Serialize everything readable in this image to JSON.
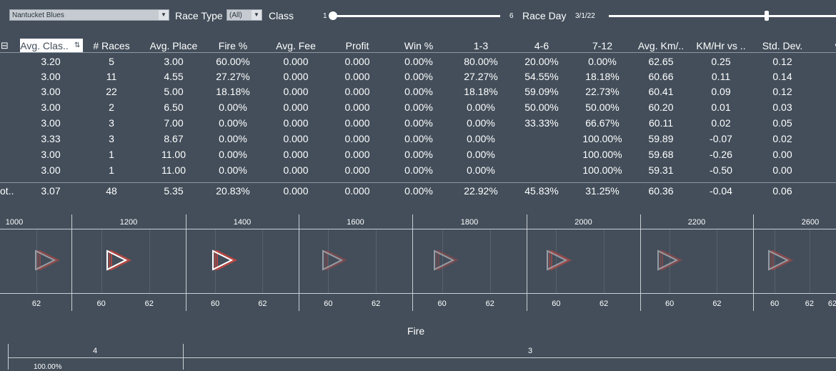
{
  "filters": {
    "track_value": "Nantucket Blues",
    "race_type_label": "Race Type",
    "race_type_value": "(All)",
    "class_label": "Class",
    "class_min": "1",
    "class_max": "6",
    "race_day_label": "Race Day",
    "race_day_value": "3/1/22"
  },
  "table": {
    "columns": [
      "Avg. Clas..",
      "# Races",
      "Avg. Place",
      "Fire %",
      "Avg. Fee",
      "Profit",
      "Win %",
      "1-3",
      "4-6",
      "7-12",
      "Avg. Km/..",
      "KM/Hr vs ..",
      "Std. Dev.",
      "v"
    ],
    "rows": [
      [
        "3.20",
        "5",
        "3.00",
        "60.00%",
        "0.000",
        "0.000",
        "0.00%",
        "80.00%",
        "20.00%",
        "0.00%",
        "62.65",
        "0.25",
        "0.12"
      ],
      [
        "3.00",
        "11",
        "4.55",
        "27.27%",
        "0.000",
        "0.000",
        "0.00%",
        "27.27%",
        "54.55%",
        "18.18%",
        "60.66",
        "0.11",
        "0.14"
      ],
      [
        "3.00",
        "22",
        "5.00",
        "18.18%",
        "0.000",
        "0.000",
        "0.00%",
        "18.18%",
        "59.09%",
        "22.73%",
        "60.41",
        "0.09",
        "0.12"
      ],
      [
        "3.00",
        "2",
        "6.50",
        "0.00%",
        "0.000",
        "0.000",
        "0.00%",
        "0.00%",
        "50.00%",
        "50.00%",
        "60.20",
        "0.01",
        "0.03"
      ],
      [
        "3.00",
        "3",
        "7.00",
        "0.00%",
        "0.000",
        "0.000",
        "0.00%",
        "0.00%",
        "33.33%",
        "66.67%",
        "60.11",
        "0.02",
        "0.05"
      ],
      [
        "3.33",
        "3",
        "8.67",
        "0.00%",
        "0.000",
        "0.000",
        "0.00%",
        "0.00%",
        "",
        "100.00%",
        "59.89",
        "-0.07",
        "0.02"
      ],
      [
        "3.00",
        "1",
        "11.00",
        "0.00%",
        "0.000",
        "0.000",
        "0.00%",
        "0.00%",
        "",
        "100.00%",
        "59.68",
        "-0.26",
        "0.00"
      ],
      [
        "3.00",
        "1",
        "11.00",
        "0.00%",
        "0.000",
        "0.000",
        "0.00%",
        "0.00%",
        "",
        "100.00%",
        "59.31",
        "-0.50",
        "0.00"
      ]
    ],
    "total_label": "ot..",
    "total": [
      "3.07",
      "48",
      "5.35",
      "20.83%",
      "0.000",
      "0.000",
      "0.00%",
      "22.92%",
      "45.83%",
      "31.25%",
      "60.36",
      "-0.04",
      "0.06"
    ]
  },
  "distance_panels": {
    "distances": [
      "1000",
      "1200",
      "1400",
      "1600",
      "1800",
      "2000",
      "2200",
      "2600"
    ],
    "axis_ticks": [
      [
        "62"
      ],
      [
        "60",
        "62"
      ],
      [
        "60",
        "62"
      ],
      [
        "60",
        "62"
      ],
      [
        "60",
        "62"
      ],
      [
        "60",
        "62"
      ],
      [
        "60",
        "62"
      ],
      [
        "60",
        "62"
      ]
    ]
  },
  "fire_section": {
    "title": "Fire",
    "col_a": "4",
    "col_b": "3",
    "value": "100.00%"
  },
  "colors": {
    "background": "#434e5a",
    "marker_red": "#c0463f",
    "marker_grey": "#b8bec5"
  }
}
